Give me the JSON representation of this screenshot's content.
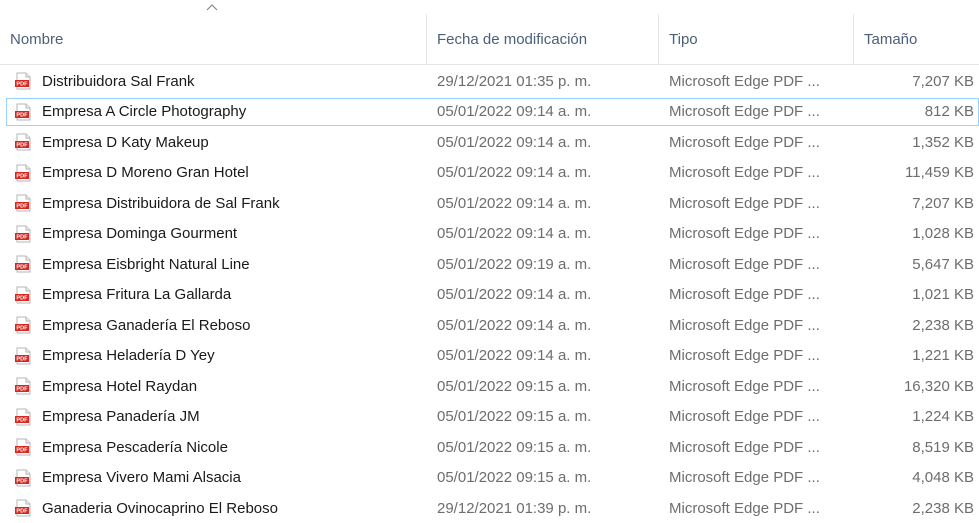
{
  "columns": {
    "name": "Nombre",
    "modified": "Fecha de modificación",
    "type": "Tipo",
    "size": "Tamaño"
  },
  "sort": {
    "column": "name",
    "direction": "ascending",
    "icon": "sort-up-caret-icon"
  },
  "file_icon": {
    "name": "pdf-file-icon",
    "label": "PDF",
    "color": "#d7261e"
  },
  "selected_index": 1,
  "files": [
    {
      "name": "Distribuidora Sal Frank",
      "modified": "29/12/2021 01:35 p. m.",
      "type": "Microsoft Edge PDF ...",
      "size": "7,207 KB"
    },
    {
      "name": "Empresa A Circle Photography",
      "modified": "05/01/2022 09:14 a. m.",
      "type": "Microsoft Edge PDF ...",
      "size": "812 KB"
    },
    {
      "name": "Empresa D Katy Makeup",
      "modified": "05/01/2022 09:14 a. m.",
      "type": "Microsoft Edge PDF ...",
      "size": "1,352 KB"
    },
    {
      "name": "Empresa D Moreno Gran Hotel",
      "modified": "05/01/2022 09:14 a. m.",
      "type": "Microsoft Edge PDF ...",
      "size": "11,459 KB"
    },
    {
      "name": "Empresa Distribuidora de Sal Frank",
      "modified": "05/01/2022 09:14 a. m.",
      "type": "Microsoft Edge PDF ...",
      "size": "7,207 KB"
    },
    {
      "name": "Empresa Dominga Gourment",
      "modified": "05/01/2022 09:14 a. m.",
      "type": "Microsoft Edge PDF ...",
      "size": "1,028 KB"
    },
    {
      "name": "Empresa Eisbright Natural Line",
      "modified": "05/01/2022 09:19 a. m.",
      "type": "Microsoft Edge PDF ...",
      "size": "5,647 KB"
    },
    {
      "name": "Empresa Fritura La Gallarda",
      "modified": "05/01/2022 09:14 a. m.",
      "type": "Microsoft Edge PDF ...",
      "size": "1,021 KB"
    },
    {
      "name": "Empresa Ganadería El Reboso",
      "modified": "05/01/2022 09:14 a. m.",
      "type": "Microsoft Edge PDF ...",
      "size": "2,238 KB"
    },
    {
      "name": "Empresa Heladería D Yey",
      "modified": "05/01/2022 09:14 a. m.",
      "type": "Microsoft Edge PDF ...",
      "size": "1,221 KB"
    },
    {
      "name": "Empresa Hotel Raydan",
      "modified": "05/01/2022 09:15 a. m.",
      "type": "Microsoft Edge PDF ...",
      "size": "16,320 KB"
    },
    {
      "name": "Empresa Panadería JM",
      "modified": "05/01/2022 09:15 a. m.",
      "type": "Microsoft Edge PDF ...",
      "size": "1,224 KB"
    },
    {
      "name": "Empresa Pescadería Nicole",
      "modified": "05/01/2022 09:15 a. m.",
      "type": "Microsoft Edge PDF ...",
      "size": "8,519 KB"
    },
    {
      "name": "Empresa Vivero Mami Alsacia",
      "modified": "05/01/2022 09:15 a. m.",
      "type": "Microsoft Edge PDF ...",
      "size": "4,048 KB"
    },
    {
      "name": "Ganaderia Ovinocaprino El Reboso",
      "modified": "29/12/2021 01:39 p. m.",
      "type": "Microsoft Edge PDF ...",
      "size": "2,238 KB"
    }
  ]
}
